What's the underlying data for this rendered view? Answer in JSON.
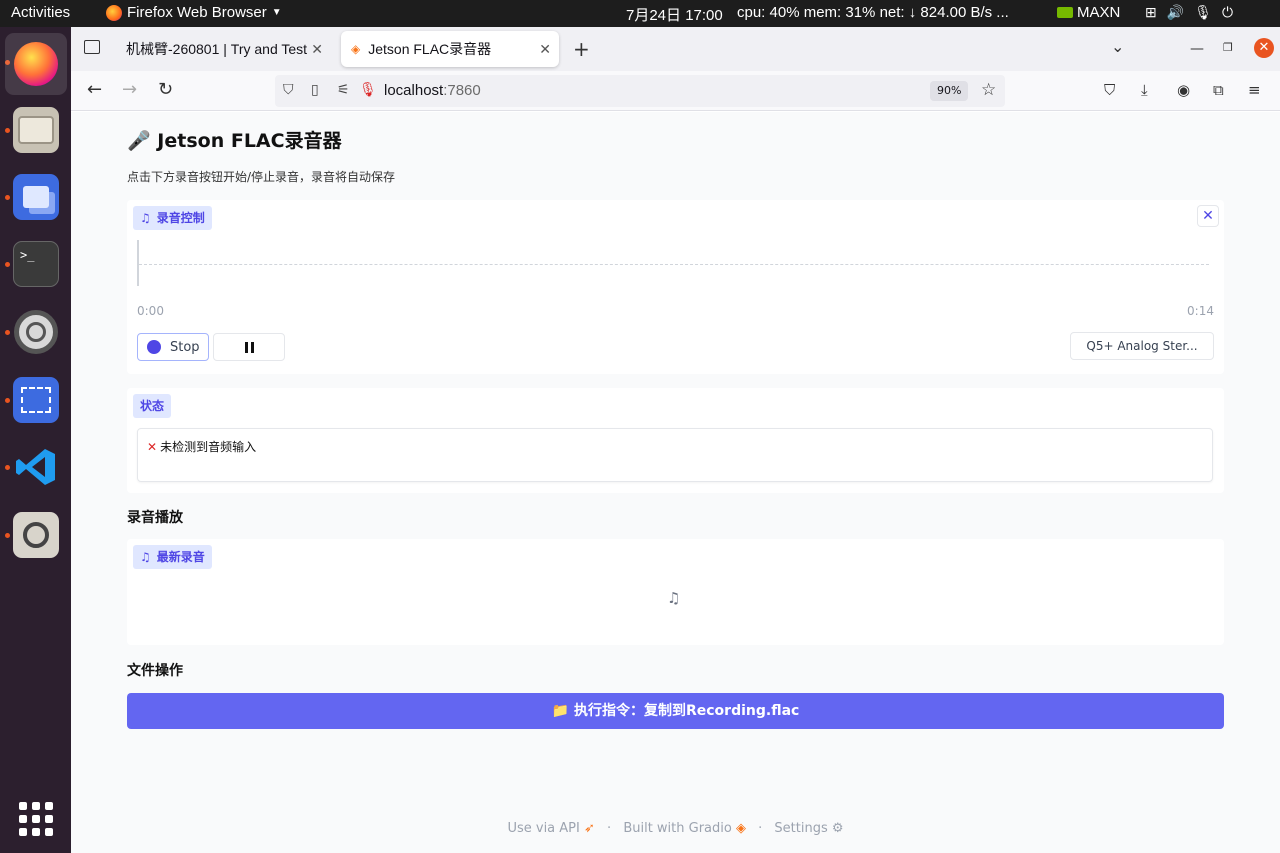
{
  "system": {
    "activities": "Activities",
    "app_name": "Firefox Web Browser",
    "clock": "7月24日  17:00",
    "stats": "cpu: 40% mem: 31% net: ↓  824.00 B/s ...",
    "power_mode": "MAXN"
  },
  "dock": {
    "items": [
      "firefox",
      "files",
      "workspace",
      "terminal",
      "settings",
      "screenshot",
      "vscode",
      "image-viewer",
      "app-grid"
    ]
  },
  "browser": {
    "tabs": [
      {
        "title": "机械臂-260801 | Try and Test"
      },
      {
        "title": "Jetson FLAC录音器"
      }
    ],
    "url_host": "localhost",
    "url_port": ":7860",
    "zoom": "90%"
  },
  "app": {
    "title": "Jetson FLAC录音器",
    "description": "点击下方录音按钮开始/停止录音，录音将自动保存",
    "recorder": {
      "label": "录音控制",
      "time_start": "0:00",
      "time_end": "0:14",
      "stop_label": "Stop",
      "device": "Q5+ Analog Ster..."
    },
    "status": {
      "label": "状态",
      "message": "未检测到音频输入"
    },
    "playback": {
      "section_title": "录音播放",
      "label": "最新录音"
    },
    "file_ops": {
      "section_title": "文件操作",
      "button_label": "执行指令：复制到Recording.flac"
    },
    "footer": {
      "api": "Use via API",
      "built": "Built with Gradio",
      "settings": "Settings"
    }
  },
  "colors": {
    "accent": "#6366f1",
    "label_bg": "#e0e7ff",
    "label_text": "#4f46e5",
    "error": "#dc2626"
  }
}
